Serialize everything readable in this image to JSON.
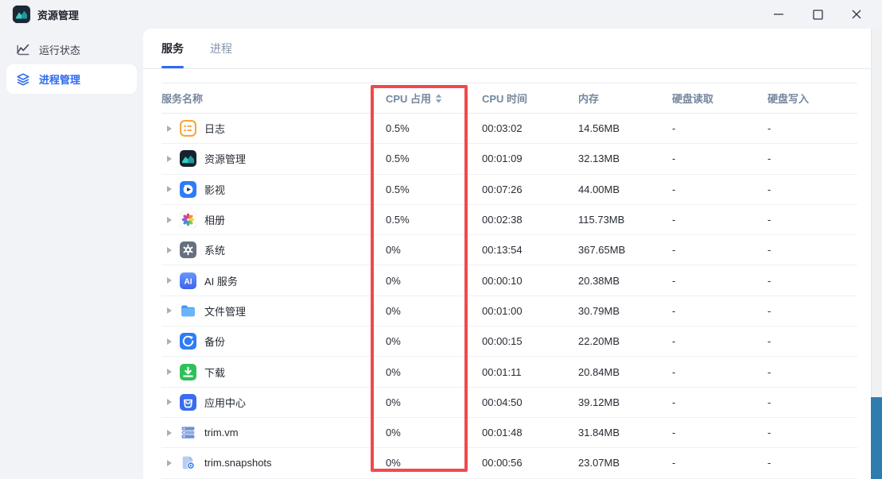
{
  "window": {
    "title": "资源管理",
    "controls": {
      "minimize": "minimize",
      "maximize": "maximize",
      "close": "close"
    }
  },
  "sidebar": {
    "items": [
      {
        "label": "运行状态",
        "icon": "line-chart",
        "active": false
      },
      {
        "label": "进程管理",
        "icon": "layers",
        "active": true
      }
    ]
  },
  "main": {
    "tabs": [
      {
        "label": "服务",
        "active": true
      },
      {
        "label": "进程",
        "active": false
      }
    ],
    "table": {
      "columns": [
        "服务名称",
        "CPU 占用",
        "CPU 时间",
        "内存",
        "硬盘读取",
        "硬盘写入"
      ],
      "sorted_column": "CPU 占用",
      "rows": [
        {
          "name": "日志",
          "icon": "log",
          "cpu_usage": "0.5%",
          "cpu_time": "00:03:02",
          "memory": "14.56MB",
          "disk_read": "-",
          "disk_write": "-"
        },
        {
          "name": "资源管理",
          "icon": "monitor",
          "cpu_usage": "0.5%",
          "cpu_time": "00:01:09",
          "memory": "32.13MB",
          "disk_read": "-",
          "disk_write": "-"
        },
        {
          "name": "影视",
          "icon": "video",
          "cpu_usage": "0.5%",
          "cpu_time": "00:07:26",
          "memory": "44.00MB",
          "disk_read": "-",
          "disk_write": "-"
        },
        {
          "name": "相册",
          "icon": "photos",
          "cpu_usage": "0.5%",
          "cpu_time": "00:02:38",
          "memory": "115.73MB",
          "disk_read": "-",
          "disk_write": "-"
        },
        {
          "name": "系统",
          "icon": "gear",
          "cpu_usage": "0%",
          "cpu_time": "00:13:54",
          "memory": "367.65MB",
          "disk_read": "-",
          "disk_write": "-"
        },
        {
          "name": "AI 服务",
          "icon": "ai",
          "cpu_usage": "0%",
          "cpu_time": "00:00:10",
          "memory": "20.38MB",
          "disk_read": "-",
          "disk_write": "-"
        },
        {
          "name": "文件管理",
          "icon": "folder",
          "cpu_usage": "0%",
          "cpu_time": "00:01:00",
          "memory": "30.79MB",
          "disk_read": "-",
          "disk_write": "-"
        },
        {
          "name": "备份",
          "icon": "backup",
          "cpu_usage": "0%",
          "cpu_time": "00:00:15",
          "memory": "22.20MB",
          "disk_read": "-",
          "disk_write": "-"
        },
        {
          "name": "下载",
          "icon": "download",
          "cpu_usage": "0%",
          "cpu_time": "00:01:11",
          "memory": "20.84MB",
          "disk_read": "-",
          "disk_write": "-"
        },
        {
          "name": "应用中心",
          "icon": "store",
          "cpu_usage": "0%",
          "cpu_time": "00:04:50",
          "memory": "39.12MB",
          "disk_read": "-",
          "disk_write": "-"
        },
        {
          "name": "trim.vm",
          "icon": "server",
          "cpu_usage": "0%",
          "cpu_time": "00:01:48",
          "memory": "31.84MB",
          "disk_read": "-",
          "disk_write": "-"
        },
        {
          "name": "trim.snapshots",
          "icon": "snapshot",
          "cpu_usage": "0%",
          "cpu_time": "00:00:56",
          "memory": "23.07MB",
          "disk_read": "-",
          "disk_write": "-"
        }
      ]
    }
  },
  "annotation": {
    "highlighted_column": "CPU 占用",
    "highlight_color": "#f1494e"
  },
  "colors": {
    "accent_blue": "#2e6bf0",
    "header_text": "#76879f",
    "panel_bg": "#f1f3f7",
    "scrollbar_thumb": "#2e7dad"
  }
}
